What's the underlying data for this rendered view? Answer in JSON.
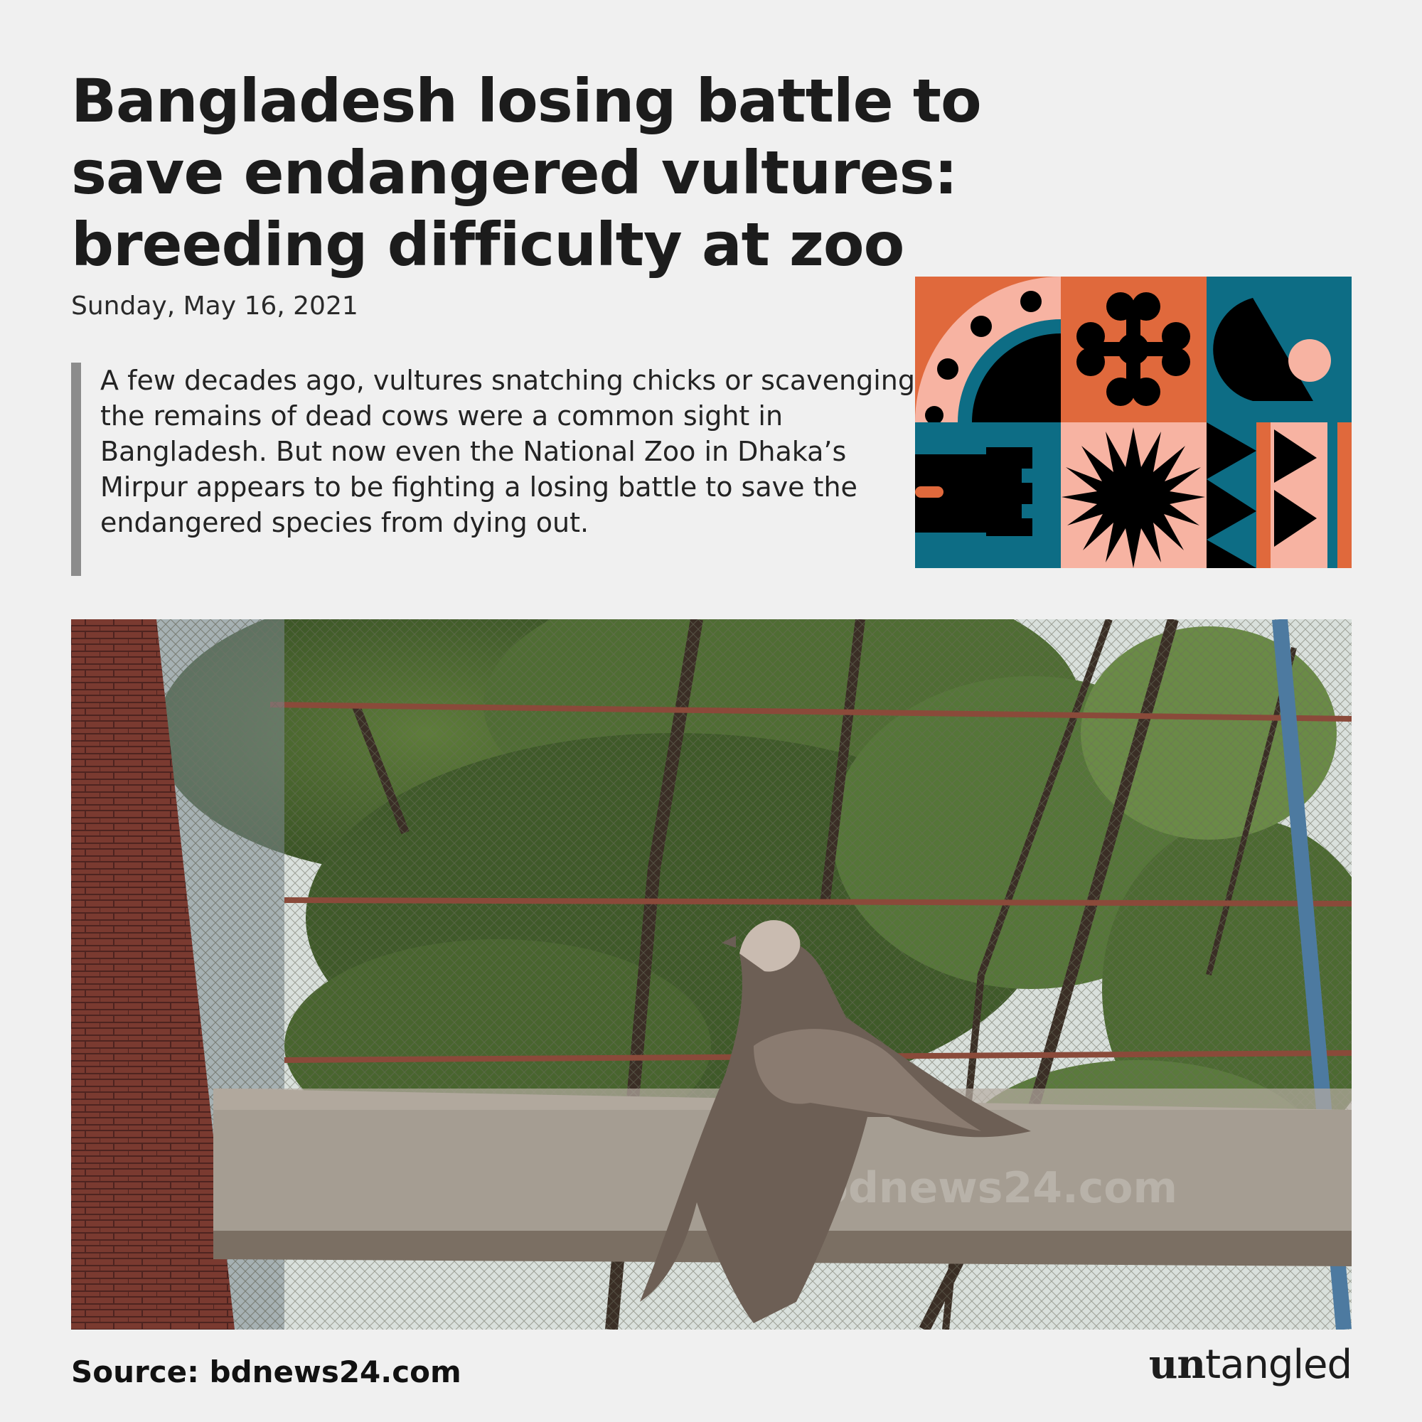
{
  "headline": "Bangladesh losing battle to save endangered vultures: breeding difficulty at zoo",
  "date": "Sunday, May 16, 2021",
  "quote": "A few decades ago, vultures snatching chicks or scavenging the remains of dead cows were a common sight in Bangladesh. But now even the National Zoo in Dhaka’s Mirpur appears to be fighting a losing battle to save the endangered species from dying out.",
  "photo_watermark": "bdnews24.com",
  "source": "Source: bdnews24.com",
  "brand": {
    "bold_part": "un",
    "light_part": "tangled"
  },
  "colors": {
    "background": "#f0f0f0",
    "pattern_orange": "#e0693c",
    "pattern_teal": "#0d6d85",
    "pattern_pink": "#f7b3a2",
    "pattern_black": "#000000",
    "quote_bar": "#8c8c8c"
  }
}
